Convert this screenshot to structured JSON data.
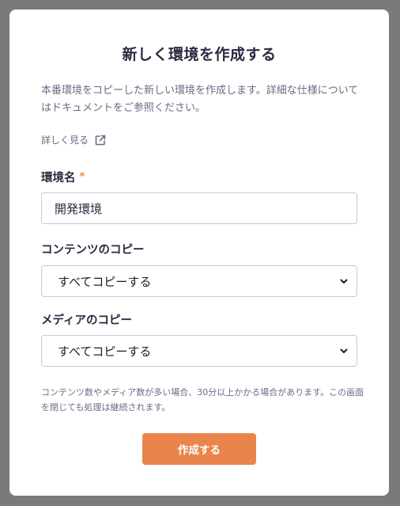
{
  "modal": {
    "title": "新しく環境を作成する",
    "description": "本番環境をコピーした新しい環境を作成します。詳細な仕様についてはドキュメントをご参照ください。",
    "more_link": "詳しく見る",
    "more_link_icon": "external-link-icon"
  },
  "env_name": {
    "label": "環境名",
    "required_mark": "*",
    "value": "開発環境"
  },
  "contents_copy": {
    "label": "コンテンツのコピー",
    "selected": "すべてコピーする",
    "icon": "chevron-down-icon"
  },
  "media_copy": {
    "label": "メディアのコピー",
    "selected": "すべてコピーする",
    "icon": "chevron-down-icon"
  },
  "note": "コンテンツ数やメディア数が多い場合、30分以上かかる場合があります。この画面を閉じても処理は継続されます。",
  "submit": {
    "label": "作成する"
  },
  "colors": {
    "accent": "#e9854a",
    "title_text": "#2b2940",
    "body_text": "#6c6a86",
    "overlay": "#7a7a7a"
  }
}
